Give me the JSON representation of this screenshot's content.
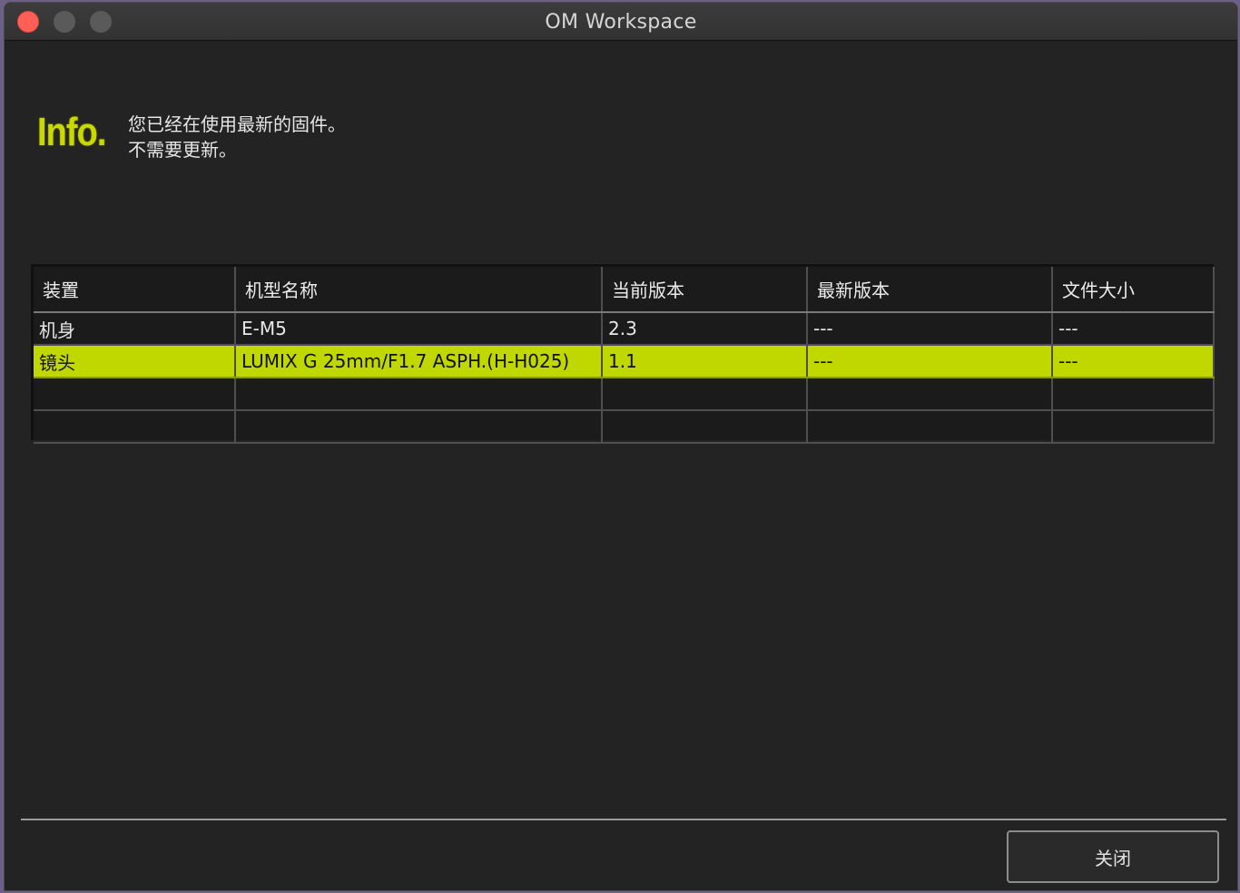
{
  "window": {
    "title": "OM Workspace"
  },
  "info": {
    "logo_text": "Info.",
    "message_line1": "您已经在使用最新的固件。",
    "message_line2": "不需要更新。"
  },
  "table": {
    "headers": [
      "装置",
      "机型名称",
      "当前版本",
      "最新版本",
      "文件大小"
    ],
    "rows": [
      [
        "机身",
        "E-M5",
        "2.3",
        "---",
        "---"
      ],
      [
        "镜头",
        "LUMIX G 25mm/F1.7 ASPH.(H-H025)",
        "1.1",
        "---",
        "---"
      ],
      [
        "",
        "",
        "",
        "",
        ""
      ],
      [
        "",
        "",
        "",
        "",
        ""
      ]
    ],
    "selected_row": 1
  },
  "footer": {
    "close_label": "关闭"
  },
  "colors": {
    "accent": "#c0d800",
    "background": "#232323",
    "close_dot": "#ff5f57"
  }
}
